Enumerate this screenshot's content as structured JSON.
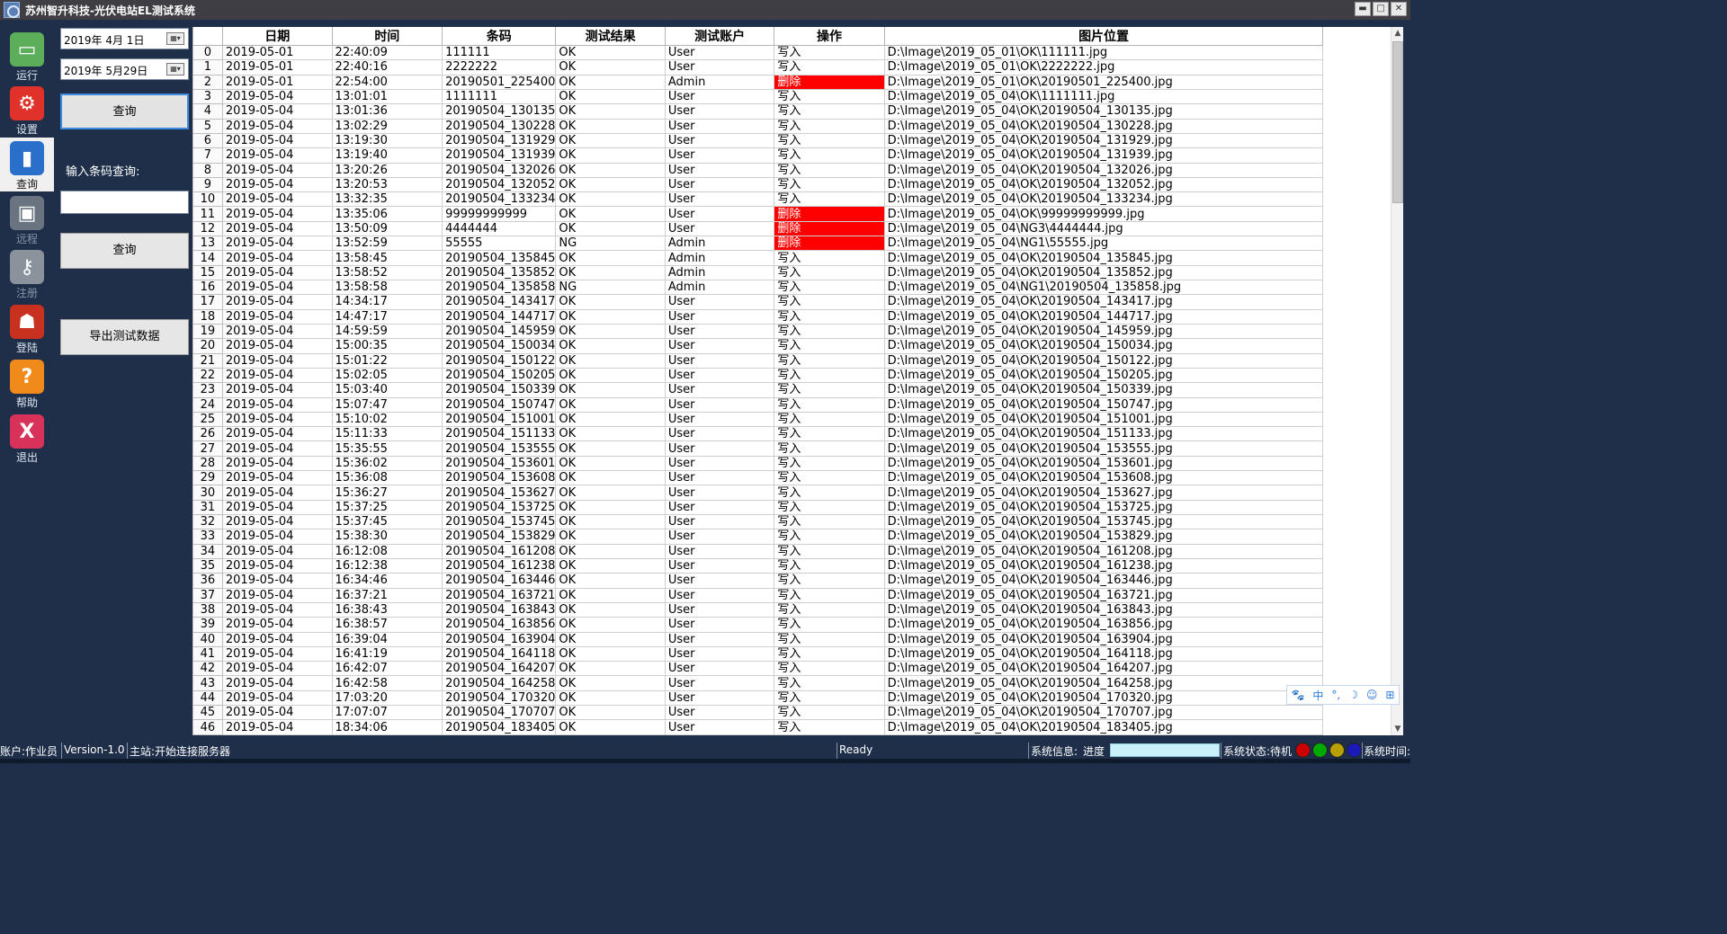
{
  "window": {
    "title": "苏州智升科技-光伏电站EL测试系统",
    "min_label": "▬",
    "max_label": "□",
    "close_label": "✕"
  },
  "nav": [
    {
      "label": "运行",
      "icon": "monitor-icon",
      "color": "#5cae5a",
      "glyph": "▭",
      "state": "normal"
    },
    {
      "label": "设置",
      "icon": "gear-icon",
      "color": "#e0322a",
      "glyph": "⚙",
      "state": "normal"
    },
    {
      "label": "查询",
      "icon": "bar-chart-icon",
      "color": "#2a6fc9",
      "glyph": "▮",
      "state": "active"
    },
    {
      "label": "远程",
      "icon": "remote-desktop-icon",
      "color": "#6a7480",
      "glyph": "▣",
      "state": "disabled"
    },
    {
      "label": "注册",
      "icon": "key-icon",
      "color": "#8a929c",
      "glyph": "⚷",
      "state": "disabled"
    },
    {
      "label": "登陆",
      "icon": "user-login-icon",
      "color": "#c8301f",
      "glyph": "☗",
      "state": "normal"
    },
    {
      "label": "帮助",
      "icon": "help-icon",
      "color": "#f08a1a",
      "glyph": "?",
      "state": "normal"
    },
    {
      "label": "退出",
      "icon": "exit-icon",
      "color": "#d8325a",
      "glyph": "X",
      "state": "normal"
    }
  ],
  "controls": {
    "date_from": "2019年  4月  1日",
    "date_to": "2019年  5月29日",
    "query_date_button": "查询",
    "barcode_label": "输入条码查询:",
    "barcode_value": "",
    "query_barcode_button": "查询",
    "export_button": "导出测试数据"
  },
  "table": {
    "columns": [
      "",
      "日期",
      "时间",
      "条码",
      "测试结果",
      "测试账户",
      "操作",
      "图片位置"
    ],
    "rows": [
      [
        "0",
        "2019-05-01",
        "22:40:09",
        "111111",
        "OK",
        "User",
        "写入",
        "D:\\Image\\2019_05_01\\OK\\111111.jpg"
      ],
      [
        "1",
        "2019-05-01",
        "22:40:16",
        "2222222",
        "OK",
        "User",
        "写入",
        "D:\\Image\\2019_05_01\\OK\\2222222.jpg"
      ],
      [
        "2",
        "2019-05-01",
        "22:54:00",
        "20190501_225400",
        "OK",
        "Admin",
        "删除",
        "D:\\Image\\2019_05_01\\OK\\20190501_225400.jpg"
      ],
      [
        "3",
        "2019-05-04",
        "13:01:01",
        "1111111",
        "OK",
        "User",
        "写入",
        "D:\\Image\\2019_05_04\\OK\\1111111.jpg"
      ],
      [
        "4",
        "2019-05-04",
        "13:01:36",
        "20190504_130135",
        "OK",
        "User",
        "写入",
        "D:\\Image\\2019_05_04\\OK\\20190504_130135.jpg"
      ],
      [
        "5",
        "2019-05-04",
        "13:02:29",
        "20190504_130228",
        "OK",
        "User",
        "写入",
        "D:\\Image\\2019_05_04\\OK\\20190504_130228.jpg"
      ],
      [
        "6",
        "2019-05-04",
        "13:19:30",
        "20190504_131929",
        "OK",
        "User",
        "写入",
        "D:\\Image\\2019_05_04\\OK\\20190504_131929.jpg"
      ],
      [
        "7",
        "2019-05-04",
        "13:19:40",
        "20190504_131939",
        "OK",
        "User",
        "写入",
        "D:\\Image\\2019_05_04\\OK\\20190504_131939.jpg"
      ],
      [
        "8",
        "2019-05-04",
        "13:20:26",
        "20190504_132026",
        "OK",
        "User",
        "写入",
        "D:\\Image\\2019_05_04\\OK\\20190504_132026.jpg"
      ],
      [
        "9",
        "2019-05-04",
        "13:20:53",
        "20190504_132052",
        "OK",
        "User",
        "写入",
        "D:\\Image\\2019_05_04\\OK\\20190504_132052.jpg"
      ],
      [
        "10",
        "2019-05-04",
        "13:32:35",
        "20190504_133234",
        "OK",
        "User",
        "写入",
        "D:\\Image\\2019_05_04\\OK\\20190504_133234.jpg"
      ],
      [
        "11",
        "2019-05-04",
        "13:35:06",
        "99999999999",
        "OK",
        "User",
        "删除",
        "D:\\Image\\2019_05_04\\OK\\99999999999.jpg"
      ],
      [
        "12",
        "2019-05-04",
        "13:50:09",
        "4444444",
        "OK",
        "User",
        "删除",
        "D:\\Image\\2019_05_04\\NG3\\4444444.jpg"
      ],
      [
        "13",
        "2019-05-04",
        "13:52:59",
        "55555",
        "NG",
        "Admin",
        "删除",
        "D:\\Image\\2019_05_04\\NG1\\55555.jpg"
      ],
      [
        "14",
        "2019-05-04",
        "13:58:45",
        "20190504_135845",
        "OK",
        "Admin",
        "写入",
        "D:\\Image\\2019_05_04\\OK\\20190504_135845.jpg"
      ],
      [
        "15",
        "2019-05-04",
        "13:58:52",
        "20190504_135852",
        "OK",
        "Admin",
        "写入",
        "D:\\Image\\2019_05_04\\OK\\20190504_135852.jpg"
      ],
      [
        "16",
        "2019-05-04",
        "13:58:58",
        "20190504_135858",
        "NG",
        "Admin",
        "写入",
        "D:\\Image\\2019_05_04\\NG1\\20190504_135858.jpg"
      ],
      [
        "17",
        "2019-05-04",
        "14:34:17",
        "20190504_143417",
        "OK",
        "User",
        "写入",
        "D:\\Image\\2019_05_04\\OK\\20190504_143417.jpg"
      ],
      [
        "18",
        "2019-05-04",
        "14:47:17",
        "20190504_144717",
        "OK",
        "User",
        "写入",
        "D:\\Image\\2019_05_04\\OK\\20190504_144717.jpg"
      ],
      [
        "19",
        "2019-05-04",
        "14:59:59",
        "20190504_145959",
        "OK",
        "User",
        "写入",
        "D:\\Image\\2019_05_04\\OK\\20190504_145959.jpg"
      ],
      [
        "20",
        "2019-05-04",
        "15:00:35",
        "20190504_150034",
        "OK",
        "User",
        "写入",
        "D:\\Image\\2019_05_04\\OK\\20190504_150034.jpg"
      ],
      [
        "21",
        "2019-05-04",
        "15:01:22",
        "20190504_150122",
        "OK",
        "User",
        "写入",
        "D:\\Image\\2019_05_04\\OK\\20190504_150122.jpg"
      ],
      [
        "22",
        "2019-05-04",
        "15:02:05",
        "20190504_150205",
        "OK",
        "User",
        "写入",
        "D:\\Image\\2019_05_04\\OK\\20190504_150205.jpg"
      ],
      [
        "23",
        "2019-05-04",
        "15:03:40",
        "20190504_150339",
        "OK",
        "User",
        "写入",
        "D:\\Image\\2019_05_04\\OK\\20190504_150339.jpg"
      ],
      [
        "24",
        "2019-05-04",
        "15:07:47",
        "20190504_150747",
        "OK",
        "User",
        "写入",
        "D:\\Image\\2019_05_04\\OK\\20190504_150747.jpg"
      ],
      [
        "25",
        "2019-05-04",
        "15:10:02",
        "20190504_151001",
        "OK",
        "User",
        "写入",
        "D:\\Image\\2019_05_04\\OK\\20190504_151001.jpg"
      ],
      [
        "26",
        "2019-05-04",
        "15:11:33",
        "20190504_151133",
        "OK",
        "User",
        "写入",
        "D:\\Image\\2019_05_04\\OK\\20190504_151133.jpg"
      ],
      [
        "27",
        "2019-05-04",
        "15:35:55",
        "20190504_153555",
        "OK",
        "User",
        "写入",
        "D:\\Image\\2019_05_04\\OK\\20190504_153555.jpg"
      ],
      [
        "28",
        "2019-05-04",
        "15:36:02",
        "20190504_153601",
        "OK",
        "User",
        "写入",
        "D:\\Image\\2019_05_04\\OK\\20190504_153601.jpg"
      ],
      [
        "29",
        "2019-05-04",
        "15:36:08",
        "20190504_153608",
        "OK",
        "User",
        "写入",
        "D:\\Image\\2019_05_04\\OK\\20190504_153608.jpg"
      ],
      [
        "30",
        "2019-05-04",
        "15:36:27",
        "20190504_153627",
        "OK",
        "User",
        "写入",
        "D:\\Image\\2019_05_04\\OK\\20190504_153627.jpg"
      ],
      [
        "31",
        "2019-05-04",
        "15:37:25",
        "20190504_153725",
        "OK",
        "User",
        "写入",
        "D:\\Image\\2019_05_04\\OK\\20190504_153725.jpg"
      ],
      [
        "32",
        "2019-05-04",
        "15:37:45",
        "20190504_153745",
        "OK",
        "User",
        "写入",
        "D:\\Image\\2019_05_04\\OK\\20190504_153745.jpg"
      ],
      [
        "33",
        "2019-05-04",
        "15:38:30",
        "20190504_153829",
        "OK",
        "User",
        "写入",
        "D:\\Image\\2019_05_04\\OK\\20190504_153829.jpg"
      ],
      [
        "34",
        "2019-05-04",
        "16:12:08",
        "20190504_161208",
        "OK",
        "User",
        "写入",
        "D:\\Image\\2019_05_04\\OK\\20190504_161208.jpg"
      ],
      [
        "35",
        "2019-05-04",
        "16:12:38",
        "20190504_161238",
        "OK",
        "User",
        "写入",
        "D:\\Image\\2019_05_04\\OK\\20190504_161238.jpg"
      ],
      [
        "36",
        "2019-05-04",
        "16:34:46",
        "20190504_163446",
        "OK",
        "User",
        "写入",
        "D:\\Image\\2019_05_04\\OK\\20190504_163446.jpg"
      ],
      [
        "37",
        "2019-05-04",
        "16:37:21",
        "20190504_163721",
        "OK",
        "User",
        "写入",
        "D:\\Image\\2019_05_04\\OK\\20190504_163721.jpg"
      ],
      [
        "38",
        "2019-05-04",
        "16:38:43",
        "20190504_163843",
        "OK",
        "User",
        "写入",
        "D:\\Image\\2019_05_04\\OK\\20190504_163843.jpg"
      ],
      [
        "39",
        "2019-05-04",
        "16:38:57",
        "20190504_163856",
        "OK",
        "User",
        "写入",
        "D:\\Image\\2019_05_04\\OK\\20190504_163856.jpg"
      ],
      [
        "40",
        "2019-05-04",
        "16:39:04",
        "20190504_163904",
        "OK",
        "User",
        "写入",
        "D:\\Image\\2019_05_04\\OK\\20190504_163904.jpg"
      ],
      [
        "41",
        "2019-05-04",
        "16:41:19",
        "20190504_164118",
        "OK",
        "User",
        "写入",
        "D:\\Image\\2019_05_04\\OK\\20190504_164118.jpg"
      ],
      [
        "42",
        "2019-05-04",
        "16:42:07",
        "20190504_164207",
        "OK",
        "User",
        "写入",
        "D:\\Image\\2019_05_04\\OK\\20190504_164207.jpg"
      ],
      [
        "43",
        "2019-05-04",
        "16:42:58",
        "20190504_164258",
        "OK",
        "User",
        "写入",
        "D:\\Image\\2019_05_04\\OK\\20190504_164258.jpg"
      ],
      [
        "44",
        "2019-05-04",
        "17:03:20",
        "20190504_170320",
        "OK",
        "User",
        "写入",
        "D:\\Image\\2019_05_04\\OK\\20190504_170320.jpg"
      ],
      [
        "45",
        "2019-05-04",
        "17:07:07",
        "20190504_170707",
        "OK",
        "User",
        "写入",
        "D:\\Image\\2019_05_04\\OK\\20190504_170707.jpg"
      ],
      [
        "46",
        "2019-05-04",
        "18:34:06",
        "20190504_183405",
        "OK",
        "User",
        "写入",
        "D:\\Image\\2019_05_04\\OK\\20190504_183405.jpg"
      ]
    ]
  },
  "ime": [
    "🐾",
    "中",
    "°,",
    "☽",
    "☺",
    "⊞"
  ],
  "status": {
    "account": "账户:作业员",
    "version": "Version-1.0",
    "master": "主站:开始连接服务器",
    "ready": "Ready",
    "sysinfo": "系统信息:",
    "progress_label": "进度",
    "progress_value": 0,
    "sysstate": "系统状态:待机",
    "lamps": [
      "#cc0000",
      "#00aa00",
      "#b8a000",
      "#1a1ab8"
    ],
    "systime": "系统时间:"
  }
}
